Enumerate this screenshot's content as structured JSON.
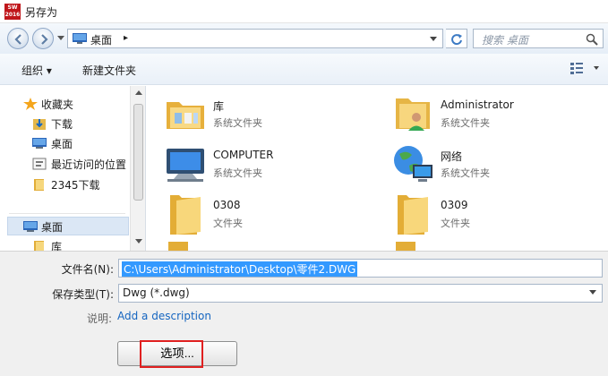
{
  "window": {
    "title": "另存为",
    "app_icon_text": "SW\n2016"
  },
  "address": {
    "location": "桌面",
    "separator": "▸",
    "search_placeholder": "搜索 桌面"
  },
  "toolbar": {
    "organize": "组织 ▾",
    "new_folder": "新建文件夹"
  },
  "sidebar": {
    "favorites_label": "收藏夹",
    "items": [
      {
        "label": "下载",
        "icon": "download-icon"
      },
      {
        "label": "桌面",
        "icon": "desktop-icon"
      },
      {
        "label": "最近访问的位置",
        "icon": "recent-places-icon"
      },
      {
        "label": "2345下载",
        "icon": "folder-icon"
      }
    ],
    "desktop_label": "桌面",
    "library_label": "库"
  },
  "files": [
    {
      "name": "库",
      "type": "系统文件夹",
      "icon": "library-folder-icon"
    },
    {
      "name": "Administrator",
      "type": "系统文件夹",
      "icon": "user-folder-icon"
    },
    {
      "name": "COMPUTER",
      "type": "系统文件夹",
      "icon": "computer-icon"
    },
    {
      "name": "网络",
      "type": "系统文件夹",
      "icon": "network-icon"
    },
    {
      "name": "0308",
      "type": "文件夹",
      "icon": "folder-icon"
    },
    {
      "name": "0309",
      "type": "文件夹",
      "icon": "folder-icon"
    }
  ],
  "form": {
    "file_name_label": "文件名(N):",
    "file_name_value": "C:\\Users\\Administrator\\Desktop\\零件2.DWG",
    "file_type_label": "保存类型(T):",
    "file_type_value": "Dwg (*.dwg)",
    "description_label": "说明:",
    "description_link": "Add a description",
    "options_button": "选项..."
  },
  "colors": {
    "selection": "#3399ff",
    "accent_link": "#1565c0",
    "highlight": "#e02020"
  }
}
